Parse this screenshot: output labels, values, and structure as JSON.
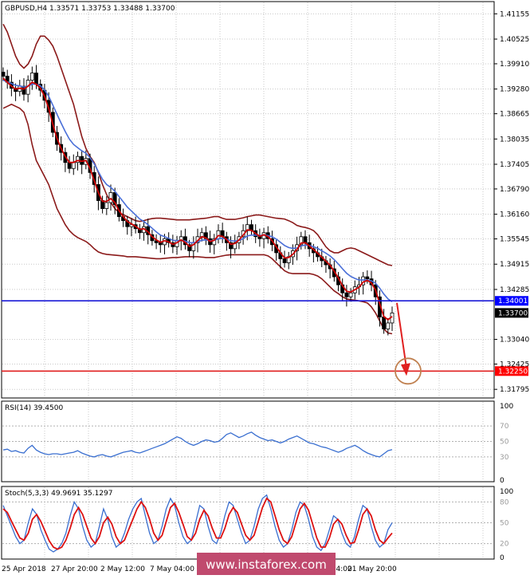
{
  "chart_data": [
    {
      "type": "candlestick",
      "title": "GBPUSD,H4  1.33571 1.33753 1.33488 1.33700",
      "symbol": "GBPUSD,H4",
      "ohlc_last": [
        1.33571,
        1.33753,
        1.33488,
        1.337
      ],
      "y_ticks": [
        "1.41155",
        "1.40525",
        "1.39910",
        "1.39280",
        "1.38665",
        "1.38035",
        "1.37405",
        "1.36790",
        "1.36160",
        "1.35545",
        "1.34915",
        "1.34285",
        "1.33040",
        "1.32425",
        "1.31795"
      ],
      "ylim": [
        1.3162,
        1.4142
      ],
      "price_labels": [
        {
          "label": "1.34001",
          "value": 1.34001,
          "color": "#0000ff"
        },
        {
          "label": "1.33700",
          "value": 1.337,
          "color": "#000000"
        },
        {
          "label": "1.32250",
          "value": 1.3225,
          "color": "#ff0000"
        }
      ],
      "horizontal_lines": [
        {
          "value": 1.34001,
          "color": "#1b1bd6"
        },
        {
          "value": 1.3225,
          "color": "#e02020"
        }
      ],
      "x_labels": [
        "25 Apr 2018",
        "27 Apr 20:00",
        "2 May 12:00",
        "7 May 04:00",
        "21 May 20:00"
      ],
      "closes": [
        1.396,
        1.3945,
        1.393,
        1.3922,
        1.3935,
        1.3915,
        1.395,
        1.3968,
        1.394,
        1.3925,
        1.39,
        1.387,
        1.382,
        1.379,
        1.377,
        1.3745,
        1.373,
        1.3745,
        1.376,
        1.374,
        1.3755,
        1.372,
        1.369,
        1.365,
        1.363,
        1.3645,
        1.367,
        1.364,
        1.361,
        1.36,
        1.3585,
        1.359,
        1.358,
        1.357,
        1.3585,
        1.3565,
        1.355,
        1.3545,
        1.354,
        1.3555,
        1.3545,
        1.3535,
        1.355,
        1.356,
        1.354,
        1.3525,
        1.3545,
        1.356,
        1.357,
        1.3555,
        1.354,
        1.3555,
        1.3575,
        1.356,
        1.3545,
        1.353,
        1.3545,
        1.356,
        1.3575,
        1.359,
        1.3575,
        1.356,
        1.3555,
        1.357,
        1.3555,
        1.354,
        1.352,
        1.3505,
        1.3495,
        1.351,
        1.3525,
        1.354,
        1.356,
        1.3545,
        1.353,
        1.352,
        1.351,
        1.35,
        1.349,
        1.348,
        1.346,
        1.344,
        1.342,
        1.341,
        1.342,
        1.3435,
        1.344,
        1.346,
        1.3455,
        1.344,
        1.341,
        1.336,
        1.333,
        1.3345,
        1.337
      ],
      "ma_red": {
        "color": "#cc0000",
        "values": [
          1.3955,
          1.3945,
          1.3935,
          1.3928,
          1.393,
          1.3928,
          1.3935,
          1.3945,
          1.394,
          1.393,
          1.391,
          1.388,
          1.384,
          1.3805,
          1.378,
          1.376,
          1.3745,
          1.3745,
          1.375,
          1.3748,
          1.375,
          1.373,
          1.37,
          1.367,
          1.3648,
          1.3648,
          1.3655,
          1.3645,
          1.3625,
          1.361,
          1.3598,
          1.3592,
          1.3586,
          1.3578,
          1.358,
          1.3572,
          1.356,
          1.3552,
          1.3546,
          1.355,
          1.3547,
          1.3541,
          1.3545,
          1.3552,
          1.3546,
          1.3536,
          1.354,
          1.355,
          1.356,
          1.3557,
          1.3548,
          1.3551,
          1.3563,
          1.3561,
          1.3553,
          1.3541,
          1.3543,
          1.3552,
          1.3564,
          1.3577,
          1.3576,
          1.3568,
          1.3561,
          1.3565,
          1.356,
          1.355,
          1.3535,
          1.352,
          1.3507,
          1.3508,
          1.3516,
          1.3528,
          1.3544,
          1.3545,
          1.3537,
          1.3528,
          1.3519,
          1.3509,
          1.3499,
          1.3489,
          1.3474,
          1.3457,
          1.3438,
          1.3424,
          1.3422,
          1.3428,
          1.3434,
          1.3447,
          1.3451,
          1.3445,
          1.3427,
          1.3393,
          1.3361,
          1.3353,
          1.3361
        ]
      },
      "ma_blue": {
        "color": "#4a6fd8",
        "values": [
          1.395,
          1.3946,
          1.3942,
          1.3937,
          1.3936,
          1.3933,
          1.3935,
          1.394,
          1.394,
          1.3936,
          1.3926,
          1.391,
          1.3888,
          1.3865,
          1.3843,
          1.3822,
          1.3803,
          1.379,
          1.3782,
          1.3774,
          1.3768,
          1.3757,
          1.3742,
          1.3722,
          1.3703,
          1.369,
          1.3683,
          1.3673,
          1.366,
          1.3647,
          1.3634,
          1.3624,
          1.3614,
          1.3604,
          1.3598,
          1.359,
          1.3581,
          1.3572,
          1.3564,
          1.356,
          1.3556,
          1.3551,
          1.355,
          1.3551,
          1.3549,
          1.3545,
          1.3545,
          1.3547,
          1.3551,
          1.3552,
          1.355,
          1.3551,
          1.3555,
          1.3556,
          1.3554,
          1.355,
          1.3549,
          1.3551,
          1.3555,
          1.3562,
          1.3564,
          1.3564,
          1.3563,
          1.3564,
          1.3563,
          1.356,
          1.3554,
          1.3546,
          1.3538,
          1.3533,
          1.3531,
          1.3532,
          1.3537,
          1.3539,
          1.3538,
          1.3535,
          1.3531,
          1.3525,
          1.3519,
          1.3512,
          1.3503,
          1.3492,
          1.348,
          1.3469,
          1.3461,
          1.3456,
          1.3452,
          1.3452,
          1.3452,
          1.345,
          1.3444,
          1.3432,
          1.3417,
          1.3405,
          1.3398
        ]
      },
      "bollinger": {
        "color": "#8b1a1a",
        "upper": [
          1.409,
          1.407,
          1.404,
          1.401,
          1.399,
          1.398,
          1.399,
          1.401,
          1.404,
          1.406,
          1.406,
          1.405,
          1.4035,
          1.401,
          1.398,
          1.395,
          1.392,
          1.389,
          1.385,
          1.381,
          1.378,
          1.376,
          1.3745,
          1.372,
          1.369,
          1.3665,
          1.3645,
          1.363,
          1.362,
          1.3615,
          1.361,
          1.3605,
          1.36,
          1.3598,
          1.36,
          1.3603,
          1.3605,
          1.3606,
          1.3606,
          1.3605,
          1.3604,
          1.3603,
          1.3602,
          1.3602,
          1.3602,
          1.3602,
          1.3603,
          1.3604,
          1.3605,
          1.3606,
          1.3608,
          1.361,
          1.361,
          1.3606,
          1.3603,
          1.3603,
          1.3603,
          1.3605,
          1.3607,
          1.361,
          1.3612,
          1.3614,
          1.3614,
          1.3612,
          1.361,
          1.3608,
          1.3606,
          1.3605,
          1.3604,
          1.36,
          1.3595,
          1.3588,
          1.3585,
          1.3583,
          1.358,
          1.3575,
          1.3565,
          1.355,
          1.3535,
          1.3525,
          1.352,
          1.352,
          1.3525,
          1.353,
          1.3532,
          1.353,
          1.3525,
          1.352,
          1.3515,
          1.351,
          1.3505,
          1.35,
          1.3495,
          1.349,
          1.3488
        ],
        "lower": [
          1.388,
          1.3885,
          1.389,
          1.3885,
          1.388,
          1.387,
          1.384,
          1.379,
          1.375,
          1.373,
          1.371,
          1.369,
          1.366,
          1.363,
          1.361,
          1.359,
          1.3575,
          1.3565,
          1.3558,
          1.3553,
          1.3548,
          1.354,
          1.353,
          1.3522,
          1.3518,
          1.3516,
          1.3515,
          1.3514,
          1.3513,
          1.3512,
          1.351,
          1.351,
          1.351,
          1.3509,
          1.3508,
          1.3507,
          1.3506,
          1.3505,
          1.3505,
          1.3506,
          1.3507,
          1.3508,
          1.3508,
          1.3509,
          1.351,
          1.351,
          1.351,
          1.351,
          1.3509,
          1.3508,
          1.3508,
          1.3508,
          1.351,
          1.3512,
          1.3514,
          1.3515,
          1.3515,
          1.3515,
          1.3515,
          1.3515,
          1.3515,
          1.3515,
          1.3515,
          1.3515,
          1.3512,
          1.3505,
          1.3495,
          1.3485,
          1.3475,
          1.347,
          1.3468,
          1.3468,
          1.3468,
          1.3468,
          1.3468,
          1.3466,
          1.3462,
          1.3455,
          1.3445,
          1.3435,
          1.3425,
          1.3418,
          1.341,
          1.3405,
          1.3403,
          1.3402,
          1.34,
          1.3398,
          1.3395,
          1.3385,
          1.337,
          1.335,
          1.333,
          1.332,
          1.3318
        ]
      },
      "annotation": {
        "type": "arrow_to_circle",
        "color": "#e02020",
        "circle_color": "#c08050",
        "from": 1.3395,
        "to": 1.3225
      }
    },
    {
      "type": "line",
      "label": "RSI(14) 39.4500",
      "ylim": [
        0,
        100
      ],
      "y_ticks": [
        "100",
        "70",
        "50",
        "30",
        "0"
      ],
      "levels": [
        70,
        50,
        30
      ],
      "series_color": "#3a6fd0",
      "values": [
        39,
        40,
        37,
        38,
        36,
        35,
        41,
        45,
        39,
        36,
        34,
        33,
        34,
        34,
        33,
        34,
        35,
        36,
        38,
        35,
        33,
        31,
        30,
        32,
        33,
        31,
        30,
        32,
        34,
        36,
        37,
        38,
        36,
        35,
        37,
        39,
        41,
        43,
        45,
        47,
        50,
        53,
        56,
        54,
        50,
        47,
        45,
        47,
        50,
        52,
        51,
        49,
        50,
        54,
        59,
        61,
        58,
        55,
        57,
        60,
        62,
        58,
        55,
        53,
        51,
        52,
        50,
        48,
        50,
        53,
        55,
        57,
        54,
        51,
        48,
        47,
        45,
        43,
        42,
        40,
        38,
        36,
        38,
        41,
        43,
        45,
        42,
        38,
        35,
        33,
        31,
        30,
        34,
        38,
        39.45
      ]
    },
    {
      "type": "line",
      "label": "Stoch(5,3,3) 49.9691 35.1297",
      "ylim": [
        0,
        100
      ],
      "y_ticks": [
        "100",
        "80",
        "50",
        "20",
        "0"
      ],
      "levels": [
        80,
        50,
        20
      ],
      "main": {
        "color": "#3a6fd0",
        "values": [
          75,
          60,
          45,
          30,
          20,
          25,
          50,
          70,
          62,
          40,
          25,
          12,
          8,
          12,
          20,
          35,
          60,
          80,
          70,
          45,
          25,
          15,
          20,
          45,
          70,
          55,
          30,
          15,
          20,
          35,
          55,
          70,
          80,
          85,
          60,
          35,
          20,
          25,
          45,
          70,
          85,
          75,
          50,
          30,
          20,
          25,
          50,
          75,
          70,
          45,
          25,
          20,
          35,
          60,
          80,
          75,
          55,
          35,
          20,
          25,
          45,
          70,
          85,
          90,
          70,
          45,
          25,
          15,
          20,
          40,
          65,
          80,
          75,
          55,
          30,
          15,
          10,
          20,
          40,
          60,
          55,
          35,
          20,
          15,
          30,
          55,
          75,
          70,
          45,
          25,
          15,
          20,
          40,
          49.97
        ]
      },
      "signal": {
        "color": "#dd1111",
        "values": [
          70,
          65,
          52,
          40,
          28,
          25,
          35,
          55,
          62,
          52,
          38,
          24,
          15,
          12,
          15,
          25,
          42,
          62,
          72,
          62,
          45,
          28,
          20,
          30,
          50,
          58,
          48,
          30,
          20,
          25,
          40,
          55,
          70,
          80,
          72,
          55,
          35,
          25,
          32,
          52,
          72,
          78,
          65,
          48,
          30,
          25,
          35,
          55,
          68,
          60,
          42,
          28,
          28,
          42,
          62,
          72,
          65,
          48,
          32,
          25,
          32,
          52,
          72,
          85,
          80,
          60,
          40,
          25,
          20,
          30,
          50,
          70,
          78,
          68,
          48,
          28,
          15,
          15,
          28,
          48,
          55,
          48,
          32,
          20,
          22,
          40,
          62,
          70,
          60,
          40,
          25,
          20,
          28,
          35.13
        ]
      },
      "x_labels": [
        "25 Apr 2018",
        "27 Apr 20:00",
        "2 May 12:00",
        "7 May 04:00",
        "18 May 04:00",
        "21 May 20:00"
      ]
    }
  ],
  "watermark": "www.instaforex.com"
}
